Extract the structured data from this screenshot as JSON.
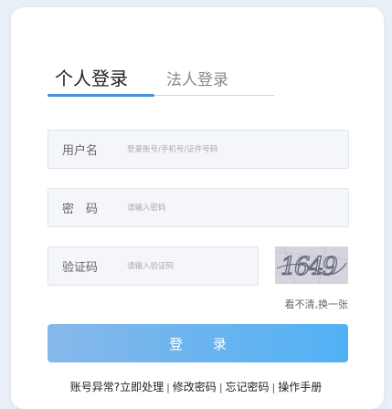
{
  "tabs": {
    "personal": "个人登录",
    "legal": "法人登录"
  },
  "fields": {
    "username": {
      "label": "用户名",
      "placeholder": "登录账号/手机号/证件号码"
    },
    "password": {
      "label": "密　码",
      "placeholder": "请输入密码"
    },
    "captcha": {
      "label": "验证码",
      "placeholder": "请输入验证码"
    }
  },
  "captcha_image": {
    "text": "1649"
  },
  "refresh_label": "看不清,换一张",
  "login_button": "登 录",
  "footer_links": [
    "账号异常?立即处理",
    "修改密码",
    "忘记密码",
    "操作手册"
  ],
  "separator": "|",
  "colors": {
    "accent": "#4a8fe0",
    "button_start": "#86b8ea",
    "button_end": "#51b1f5"
  }
}
